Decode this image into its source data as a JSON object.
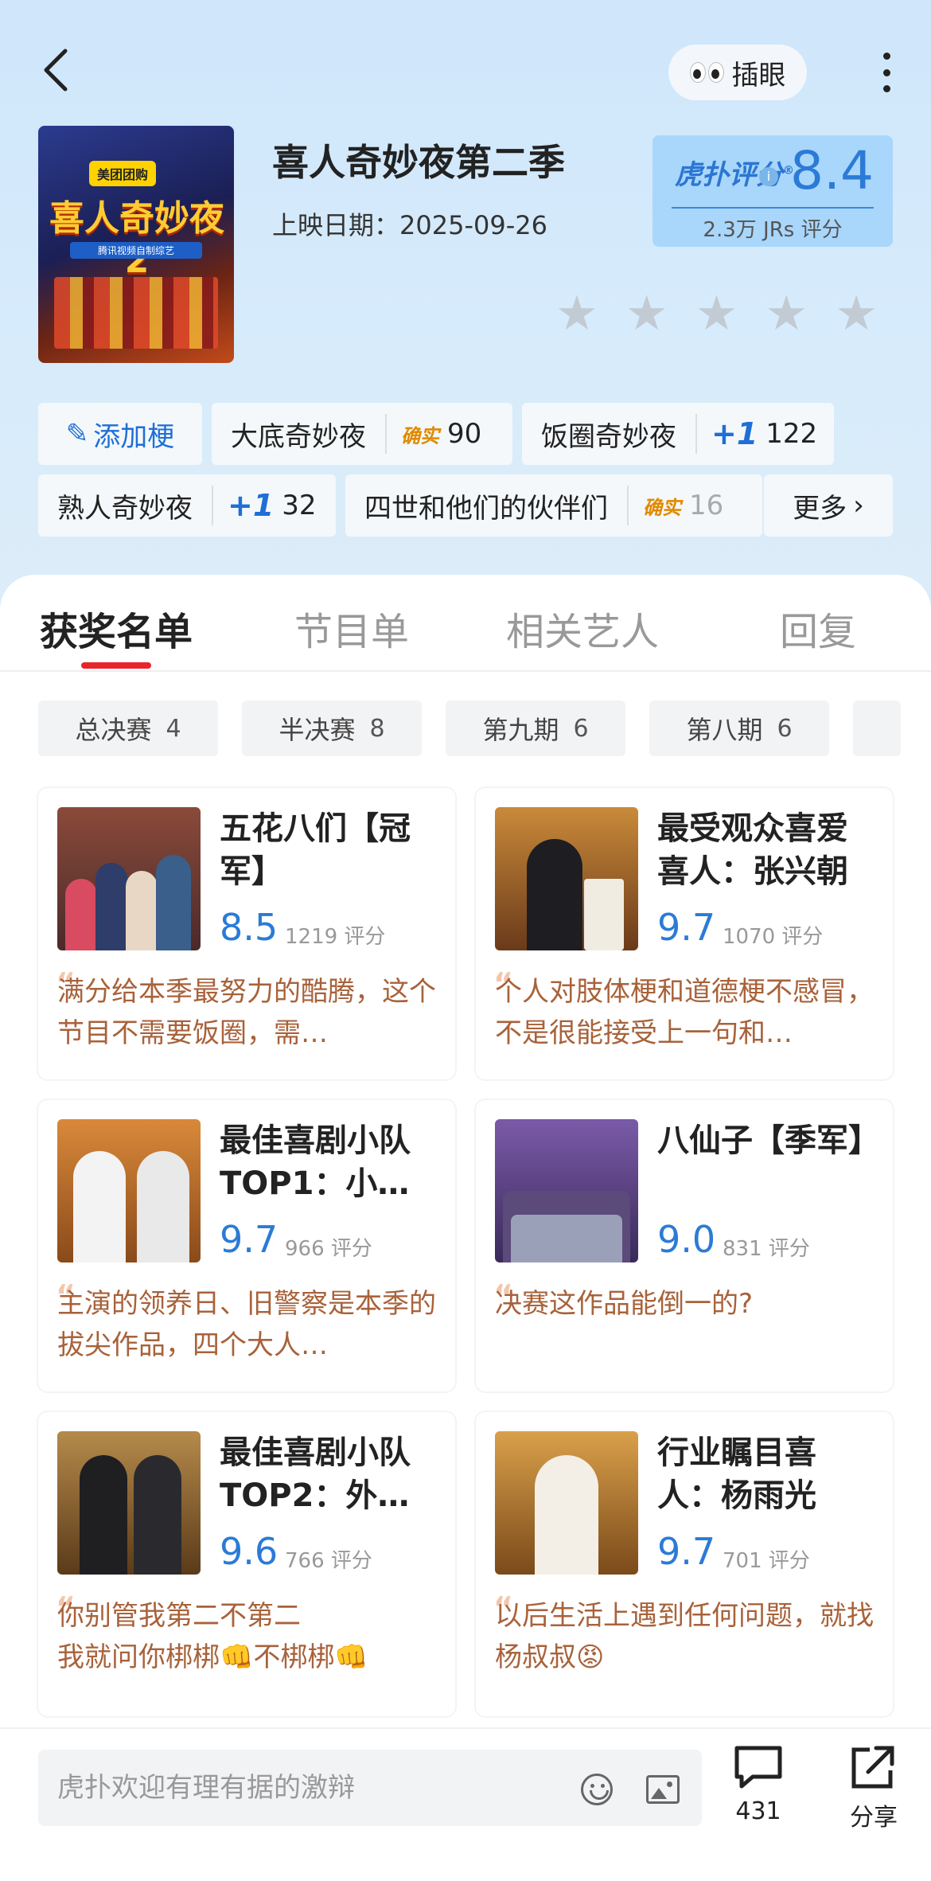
{
  "header": {
    "peek_label": "插眼",
    "title": "喜人奇妙夜第二季",
    "release": "上映日期：2025-09-26",
    "score_brand": "虎扑评分",
    "score": "8.4",
    "score_count": "2.3万 JRs 评分",
    "poster_title": "喜人奇妙夜2",
    "poster_brand": "美团团购",
    "poster_sub": "腾讯视频自制综艺"
  },
  "tags": [
    {
      "name": "添加梗"
    },
    {
      "name": "大底奇妙夜",
      "badge": "确实",
      "count": "90"
    },
    {
      "name": "饭圈奇妙夜",
      "badge": "+1",
      "count": "122"
    },
    {
      "name": "熟人奇妙夜",
      "badge": "+1",
      "count": "32"
    },
    {
      "name": "四世和他们的伙伴们",
      "badge": "确实",
      "count": "16"
    },
    {
      "name": "更多"
    }
  ],
  "tabs": [
    "获奖名单",
    "节目单",
    "相关艺人",
    "回复"
  ],
  "filters": [
    {
      "label": "总决赛",
      "count": "4"
    },
    {
      "label": "半决赛",
      "count": "8"
    },
    {
      "label": "第九期",
      "count": "6"
    },
    {
      "label": "第八期",
      "count": "6"
    }
  ],
  "cards": [
    {
      "title": "五花八们【冠军】",
      "score": "8.5",
      "count": "1219 评分",
      "quote": "满分给本季最努力的酷腾，这个节目不需要饭圈，需…"
    },
    {
      "title": "最受观众喜爱喜人：张兴朝",
      "score": "9.7",
      "count": "1070 评分",
      "quote": "个人对肢体梗和道德梗不感冒，不是很能接受上一句和…"
    },
    {
      "title": "最佳喜剧小队TOP1：小…",
      "score": "9.7",
      "count": "966 评分",
      "quote": "主演的领养日、旧警察是本季的拔尖作品，四个大人…"
    },
    {
      "title": "八仙子【季军】",
      "score": "9.0",
      "count": "831 评分",
      "quote": "决赛这作品能倒一的?"
    },
    {
      "title": "最佳喜剧小队TOP2：外…",
      "score": "9.6",
      "count": "766 评分",
      "quote": "你别管我第二不第二\n我就问你梆梆👊不梆梆👊"
    },
    {
      "title": "行业瞩目喜人：杨雨光",
      "score": "9.7",
      "count": "701 评分",
      "quote": "以后生活上遇到任何问题，就找杨叔叔😡"
    }
  ],
  "bottom": {
    "placeholder": "虎扑欢迎有理有据的激辩",
    "comment_count": "431",
    "share_label": "分享"
  },
  "colors": {
    "accent_blue": "#2b7bd6",
    "tab_indicator": "#e8252b",
    "quote_text": "#a8623a",
    "badge_real": "#e08a00"
  }
}
